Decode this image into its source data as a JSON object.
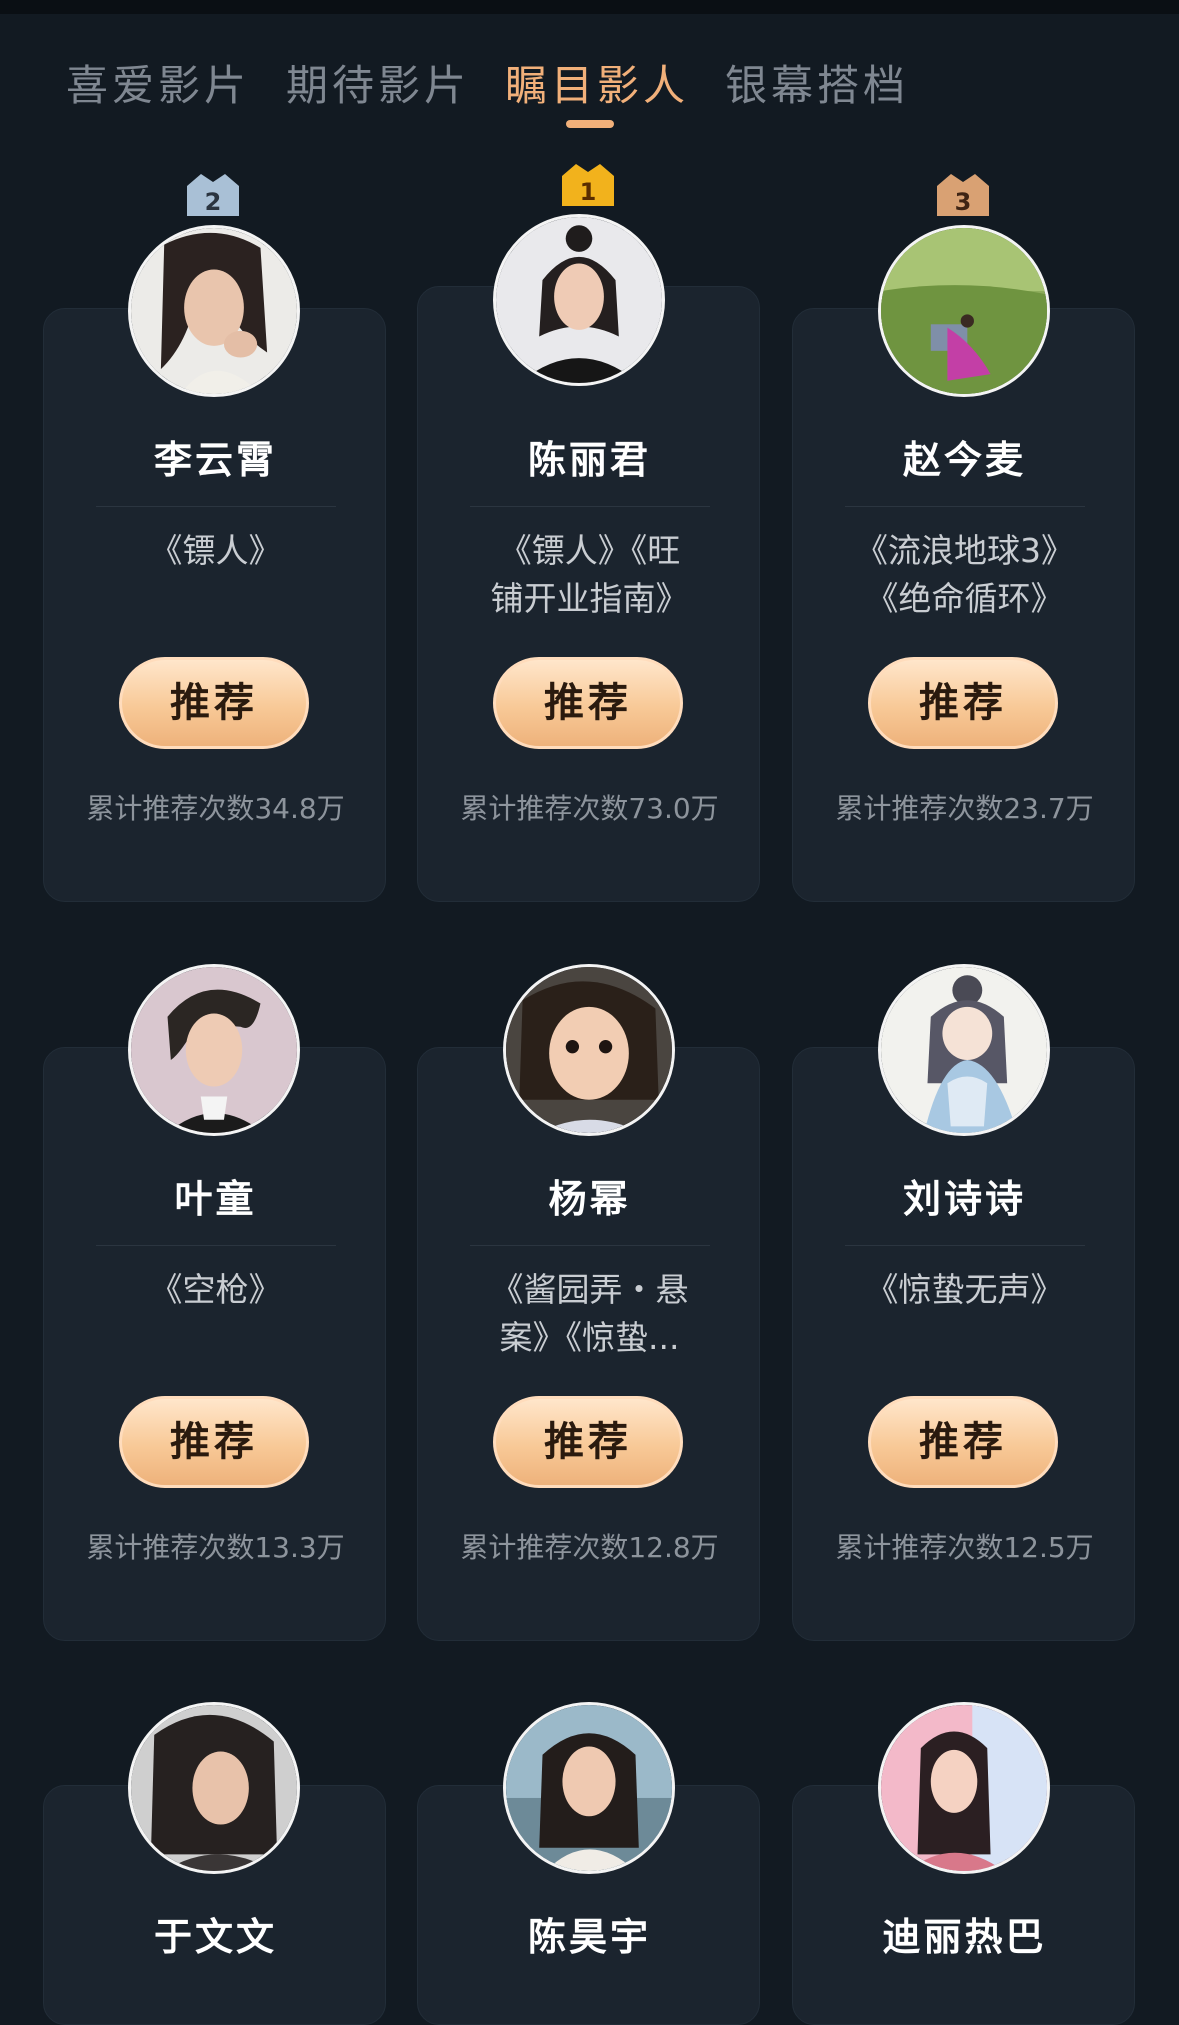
{
  "tabs": [
    {
      "label": "喜爱影片",
      "active": false
    },
    {
      "label": "期待影片",
      "active": false
    },
    {
      "label": "瞩目影人",
      "active": true
    },
    {
      "label": "银幕搭档",
      "active": false
    }
  ],
  "button_label": "推荐",
  "colors": {
    "background": "#121a22",
    "card": "#1b242e",
    "accent": "#f1b07a",
    "crown_gold": "#f2b21c",
    "crown_silver": "#a9c0d6",
    "crown_bronze": "#d9a173"
  },
  "people": [
    {
      "rank": "2",
      "name": "李云霄",
      "works": "《镖人》",
      "works_2": "",
      "count": "累计推荐次数34.8万"
    },
    {
      "rank": "1",
      "name": "陈丽君",
      "works": "《镖人》《旺",
      "works_2": "铺开业指南》",
      "count": "累计推荐次数73.0万"
    },
    {
      "rank": "3",
      "name": "赵今麦",
      "works": "《流浪地球3》",
      "works_2": "《绝命循环》",
      "count": "累计推荐次数23.7万"
    },
    {
      "rank": "",
      "name": "叶童",
      "works": "《空枪》",
      "works_2": "",
      "count": "累计推荐次数13.3万"
    },
    {
      "rank": "",
      "name": "杨幂",
      "works": "《酱园弄・悬",
      "works_2": "案》《惊蛰...",
      "count": "累计推荐次数12.8万"
    },
    {
      "rank": "",
      "name": "刘诗诗",
      "works": "《惊蛰无声》",
      "works_2": "",
      "count": "累计推荐次数12.5万"
    },
    {
      "rank": "",
      "name": "于文文",
      "works": "",
      "works_2": "",
      "count": ""
    },
    {
      "rank": "",
      "name": "陈昊宇",
      "works": "",
      "works_2": "",
      "count": ""
    },
    {
      "rank": "",
      "name": "迪丽热巴",
      "works": "",
      "works_2": "",
      "count": ""
    }
  ]
}
